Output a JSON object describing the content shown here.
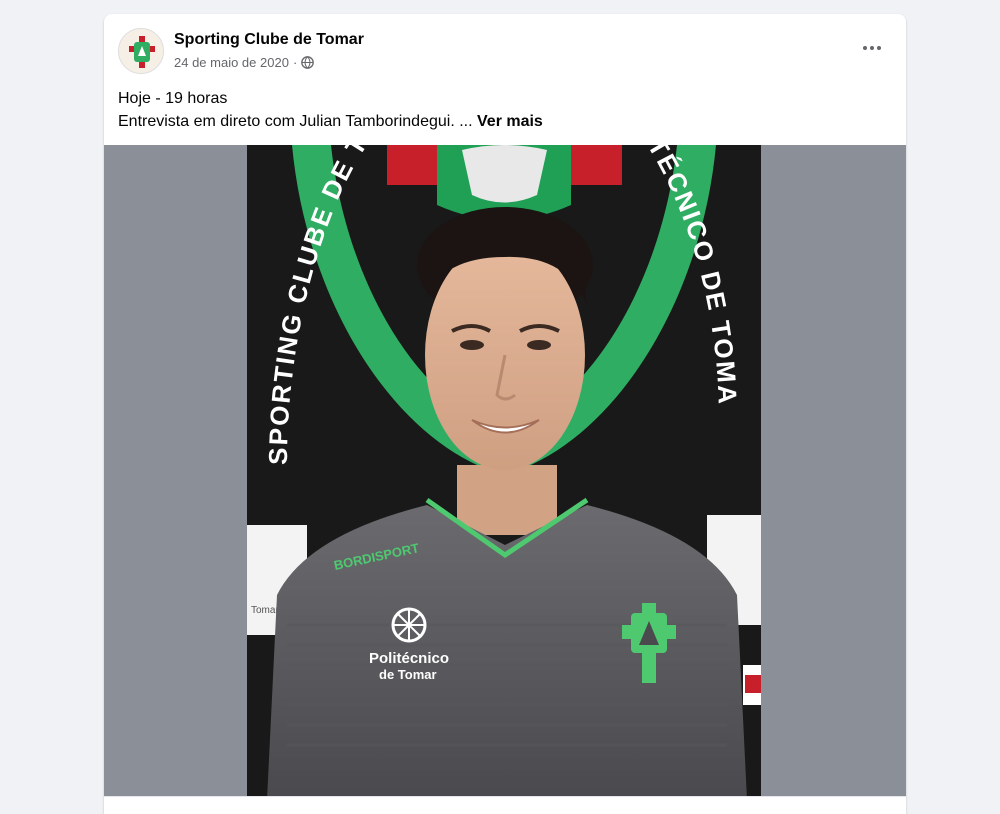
{
  "post": {
    "page_name": "Sporting Clube de Tomar",
    "date": "24 de maio de 2020",
    "separator": "·",
    "privacy_icon": "globe-icon",
    "more_icon": "more-horizontal-icon",
    "text_line1": "Hoje - 19 horas",
    "text_line2": "Entrevista em direto com Julian Tamborindegui. ...",
    "see_more": "Ver mais"
  },
  "photo": {
    "banner_left_text": "SPORTING CLUBE DE TO",
    "banner_right_text": "TÉCNICO DE TOMA",
    "shirt_brand": "BORDISPORT",
    "sponsor_line1": "Politécnico",
    "sponsor_line2": "de Tomar",
    "side_label": "Tomar"
  },
  "colors": {
    "accent_green": "#2fae63",
    "shirt_gray": "#5d5d61",
    "club_red": "#c8202a",
    "media_bg": "#8a8f98"
  }
}
